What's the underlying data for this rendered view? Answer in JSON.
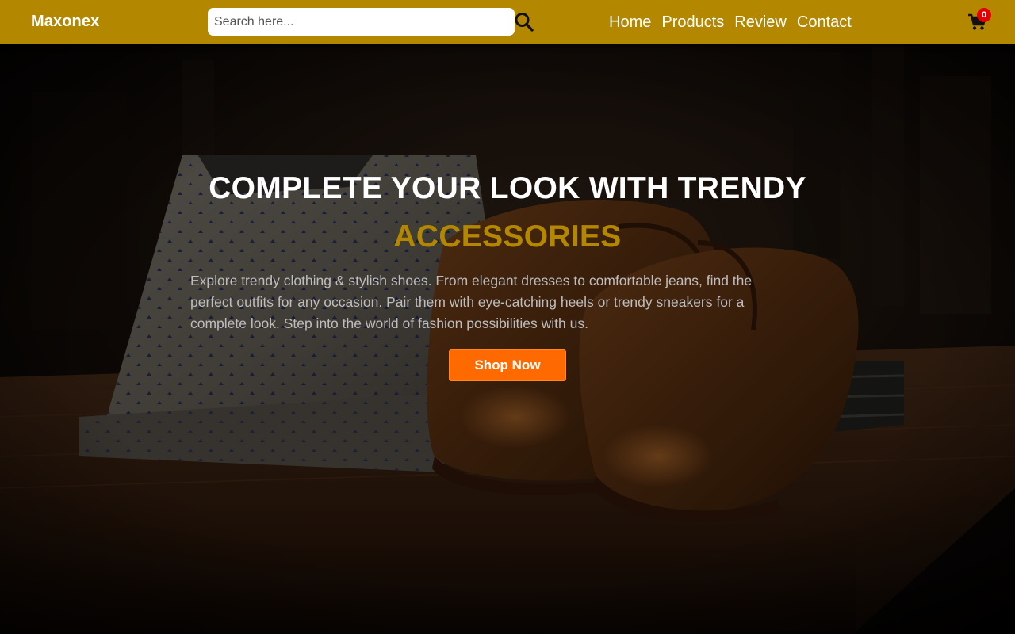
{
  "header": {
    "brand": "Maxonex",
    "search": {
      "placeholder": "Search here...",
      "value": ""
    },
    "nav_links": [
      "Home",
      "Products",
      "Review",
      "Contact"
    ],
    "cart": {
      "count": "0"
    }
  },
  "hero": {
    "title": "COMPLETE YOUR LOOK WITH TRENDY",
    "accent": "ACCESSORIES",
    "description": "Explore trendy clothing & stylish shoes. From elegant dresses to comfortable jeans, find the perfect outfits for any occasion. Pair them with eye-catching heels or trendy sneakers for a complete look. Step into the world of fashion possibilities with us.",
    "cta_label": "Shop Now"
  },
  "colors": {
    "navbar": "#b38800",
    "accent_text": "#b38800",
    "cta": "#ff6a00",
    "badge": "#e40000"
  }
}
